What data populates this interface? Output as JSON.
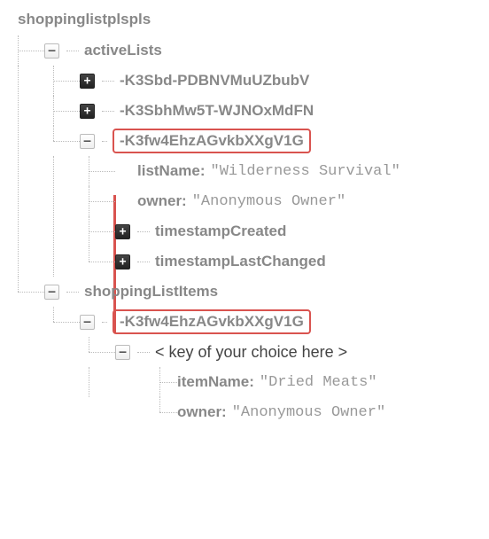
{
  "root": "shoppinglistplspls",
  "activeLists": {
    "label": "activeLists",
    "items": [
      {
        "id": "-K3Sbd-PDBNVMuUZbubV"
      },
      {
        "id": "-K3SbhMw5T-WJNOxMdFN"
      },
      {
        "id": "-K3fw4EhzAGvkbXXgV1G",
        "listName_key": "listName:",
        "listName_val": "\"Wilderness Survival\"",
        "owner_key": "owner:",
        "owner_val": "\"Anonymous Owner\"",
        "tsCreated": "timestampCreated",
        "tsChanged": "timestampLastChanged"
      }
    ]
  },
  "shoppingListItems": {
    "label": "shoppingListItems",
    "id": "-K3fw4EhzAGvkbXXgV1G",
    "placeholder": "< key of your choice here >",
    "itemName_key": "itemName:",
    "itemName_val": "\"Dried Meats\"",
    "owner_key": "owner:",
    "owner_val": "\"Anonymous Owner\""
  },
  "icons": {
    "plus": "+",
    "minus": "–"
  }
}
